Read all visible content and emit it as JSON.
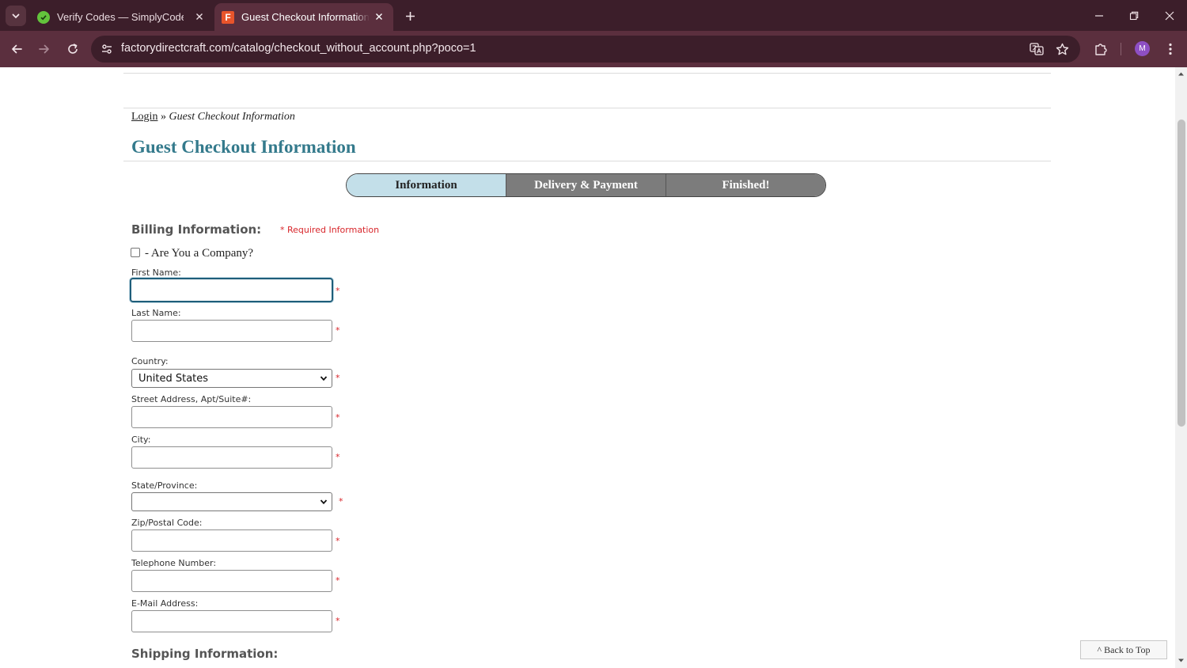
{
  "browser": {
    "tabs": [
      {
        "title": "Verify Codes — SimplyCodes",
        "icon": "simplycodes-favicon",
        "active": false
      },
      {
        "title": "Guest Checkout Information - F",
        "icon": "factorydirect-favicon",
        "favicon_letter": "F",
        "active": true
      }
    ],
    "url": "factorydirectcraft.com/catalog/checkout_without_account.php?poco=1",
    "profile_initial": "M",
    "colors": {
      "tabstrip": "#3c1e2a",
      "toolbar": "#5b2f3e"
    }
  },
  "page": {
    "breadcrumb": {
      "login": "Login",
      "separator": "»",
      "current": "Guest Checkout Information"
    },
    "title": "Guest Checkout Information",
    "steps": [
      "Information",
      "Delivery & Payment",
      "Finished!"
    ],
    "active_step": "Information",
    "billing": {
      "heading": "Billing Information:",
      "required_note": "* Required Information",
      "company_label": "- Are You a Company?",
      "required_mark": "*",
      "fields": {
        "first_name": {
          "label": "First Name:",
          "value": ""
        },
        "last_name": {
          "label": "Last Name:",
          "value": ""
        },
        "country": {
          "label": "Country:",
          "value": "United States"
        },
        "street": {
          "label": "Street Address, Apt/Suite#:",
          "value": ""
        },
        "city": {
          "label": "City:",
          "value": ""
        },
        "state": {
          "label": "State/Province:",
          "value": ""
        },
        "zip": {
          "label": "Zip/Postal Code:",
          "value": ""
        },
        "phone": {
          "label": "Telephone Number:",
          "value": ""
        },
        "email": {
          "label": "E-Mail Address:",
          "value": ""
        }
      }
    },
    "shipping_heading": "Shipping Information:",
    "back_to_top": "^ Back to Top",
    "colors": {
      "title": "#347a8c",
      "required": "#d8262b",
      "step_active": "#c3dfe9",
      "step_inactive": "#7c7c7c"
    }
  }
}
